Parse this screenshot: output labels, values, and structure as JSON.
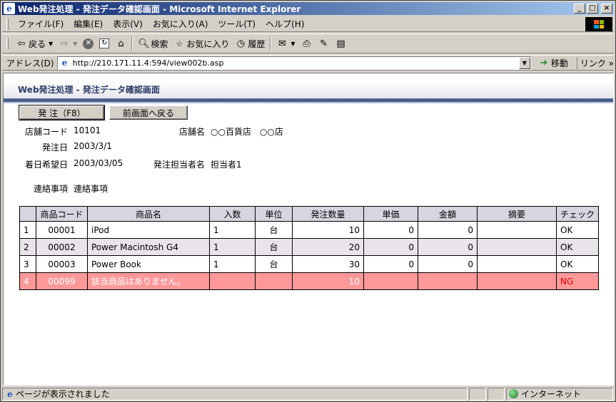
{
  "window": {
    "title": "Web発注処理 - 発注データ確認画面 - Microsoft Internet Explorer",
    "controls": {
      "minimize": "_",
      "maximize": "□",
      "close": "×"
    }
  },
  "menu": [
    "ファイル(F)",
    "編集(E)",
    "表示(V)",
    "お気に入り(A)",
    "ツール(T)",
    "ヘルプ(H)"
  ],
  "toolbar": {
    "back": "戻る",
    "search": "検索",
    "favorites": "お気に入り",
    "history": "履歴"
  },
  "address": {
    "label": "アドレス(D)",
    "url": "http://210.171.11.4:594/view002b.asp",
    "go": "移動",
    "links": "リンク »"
  },
  "page": {
    "header": "Web発注処理 - 発注データ確認画面",
    "order_button": "発 注（F8）",
    "back_button": "前画面へ戻る",
    "fields": {
      "store_code_label": "店舗コード",
      "store_code": "10101",
      "store_name_label": "店舗名",
      "store_name": "○○百貨店　○○店",
      "order_date_label": "発注日",
      "order_date": "2003/3/1",
      "arrival_date_label": "着日希望日",
      "arrival_date": "2003/03/05",
      "person_label": "発注担当者名",
      "person": "担当者1",
      "notes_label": "連絡事項",
      "notes": "連絡事項"
    },
    "table": {
      "headers": [
        "",
        "商品コード",
        "商品名",
        "入数",
        "単位",
        "発注数量",
        "単価",
        "金額",
        "摘要",
        "チェック"
      ],
      "rows": [
        {
          "no": "1",
          "code": "00001",
          "name": "iPod",
          "qty_per": "1",
          "unit": "台",
          "order_qty": "10",
          "price": "0",
          "amount": "0",
          "memo": "",
          "check": "OK"
        },
        {
          "no": "2",
          "code": "00002",
          "name": "Power Macintosh G4",
          "qty_per": "1",
          "unit": "台",
          "order_qty": "20",
          "price": "0",
          "amount": "0",
          "memo": "",
          "check": "OK"
        },
        {
          "no": "3",
          "code": "00003",
          "name": "Power Book",
          "qty_per": "1",
          "unit": "台",
          "order_qty": "30",
          "price": "0",
          "amount": "0",
          "memo": "",
          "check": "OK"
        },
        {
          "no": "4",
          "code": "00099",
          "name": "該当商品はありません。",
          "qty_per": "",
          "unit": "",
          "order_qty": "10",
          "price": "",
          "amount": "",
          "memo": "",
          "check": "NG"
        }
      ]
    }
  },
  "status": {
    "text": "ページが表示されました",
    "zone": "インターネット"
  },
  "colors": {
    "title_gradient_start": "#0a246a",
    "header_bar": "#4a5f8c",
    "ng_row": "#ff9999",
    "ng_text": "#e00000"
  }
}
